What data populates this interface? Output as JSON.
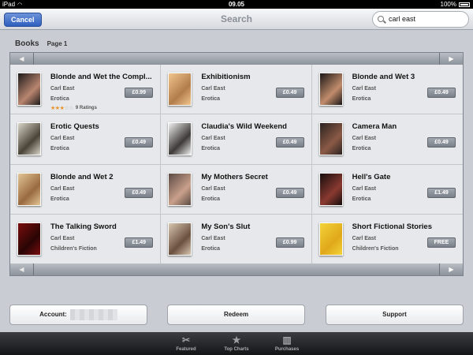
{
  "status_bar": {
    "device": "iPad",
    "time": "09.05",
    "battery": "100%"
  },
  "nav": {
    "cancel_label": "Cancel",
    "title": "Search",
    "search_value": "carl east"
  },
  "section": {
    "title": "Books",
    "page": "Page 1"
  },
  "books": [
    {
      "title": "Blonde and Wet the Compl...",
      "author": "Carl East",
      "category": "Erotica",
      "price": "£0.99",
      "rating_stars": 3,
      "rating_count": "9 Ratings",
      "cover": [
        "#1c1a1a",
        "#b9856f"
      ]
    },
    {
      "title": "Exhibitionism",
      "author": "Carl East",
      "category": "Erotica",
      "price": "£0.49",
      "cover": [
        "#f1c58d",
        "#b27d4c"
      ]
    },
    {
      "title": "Blonde and Wet 3",
      "author": "Carl East",
      "category": "Erotica",
      "price": "£0.49",
      "cover": [
        "#1a1616",
        "#c18c6c"
      ]
    },
    {
      "title": "Erotic Quests",
      "author": "Carl East",
      "category": "Erotica",
      "price": "£0.49",
      "cover": [
        "#d8d4c8",
        "#4a4338"
      ]
    },
    {
      "title": "Claudia's Wild Weekend",
      "author": "Carl East",
      "category": "Erotica",
      "price": "£0.49",
      "cover": [
        "#f0f0f0",
        "#3d3a38"
      ]
    },
    {
      "title": "Camera Man",
      "author": "Carl East",
      "category": "Erotica",
      "price": "£0.49",
      "cover": [
        "#2a2220",
        "#8a5a46"
      ]
    },
    {
      "title": "Blonde and Wet 2",
      "author": "Carl East",
      "category": "Erotica",
      "price": "£0.49",
      "cover": [
        "#e2c596",
        "#9a6a40"
      ]
    },
    {
      "title": "My Mothers Secret",
      "author": "Carl East",
      "category": "Erotica",
      "price": "£0.49",
      "cover": [
        "#5a4a44",
        "#c9a08a"
      ]
    },
    {
      "title": "Hell's Gate",
      "author": "Carl East",
      "category": "Erotica",
      "price": "£1.49",
      "cover": [
        "#140d0d",
        "#8a3a30"
      ]
    },
    {
      "title": "The Talking Sword",
      "author": "Carl East",
      "category": "Children's Fiction",
      "price": "£1.49",
      "cover": [
        "#7a0d0d",
        "#2a0505"
      ]
    },
    {
      "title": "My Son's Slut",
      "author": "Carl East",
      "category": "Erotica",
      "price": "£0.99",
      "cover": [
        "#d7c6b0",
        "#6b5140"
      ]
    },
    {
      "title": "Short Fictional Stories",
      "author": "Carl East",
      "category": "Children's Fiction",
      "price": "FREE",
      "cover": [
        "#f3d33a",
        "#e0a81a"
      ]
    }
  ],
  "buttons": {
    "account_label": "Account:",
    "redeem_label": "Redeem",
    "support_label": "Support"
  },
  "tabs": [
    {
      "label": "Featured",
      "icon": "featured-icon",
      "glyph": "✂"
    },
    {
      "label": "Top Charts",
      "icon": "star-icon",
      "glyph": "★"
    },
    {
      "label": "Purchases",
      "icon": "purchases-icon",
      "glyph": "▥"
    }
  ],
  "colors": {
    "accent": "#2f5fbf",
    "star": "#e8922a",
    "price_button": "#7a8089"
  }
}
